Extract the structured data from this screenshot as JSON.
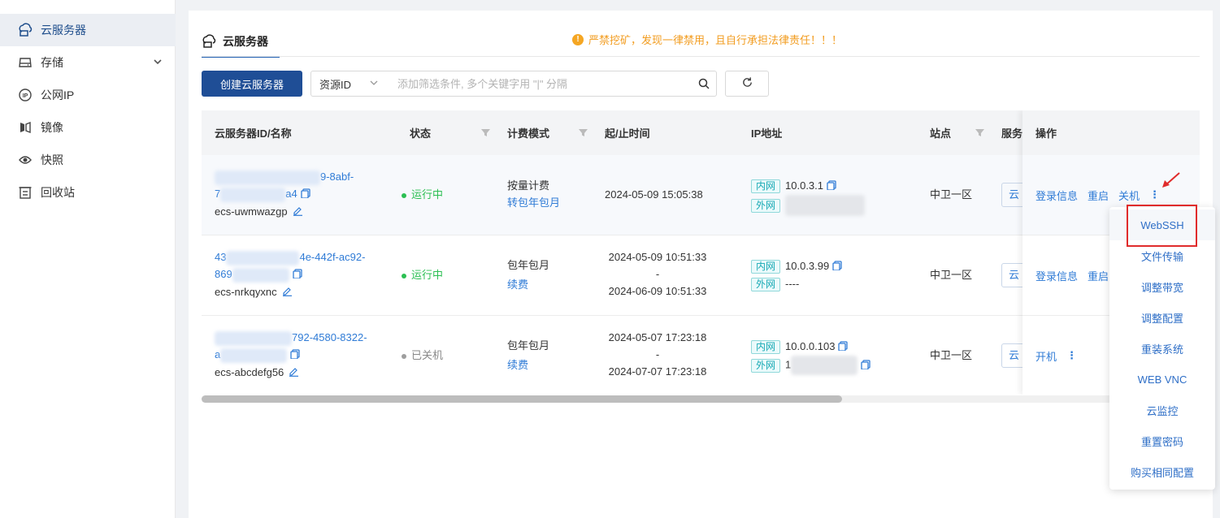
{
  "sidebar": {
    "items": [
      {
        "label": "云服务器",
        "icon": "cloud-server-icon",
        "active": true
      },
      {
        "label": "存储",
        "icon": "storage-icon"
      },
      {
        "label": "公网IP",
        "icon": "ip-icon"
      },
      {
        "label": "镜像",
        "icon": "image-icon"
      },
      {
        "label": "快照",
        "icon": "snapshot-icon"
      },
      {
        "label": "回收站",
        "icon": "recycle-bin-icon"
      }
    ]
  },
  "header": {
    "tab_label": "云服务器",
    "warning": "严禁挖矿，发现一律禁用，且自行承担法律责任！！！",
    "warning_icon": "!"
  },
  "toolbar": {
    "create_label": "创建云服务器",
    "filter_select": "资源ID",
    "search_placeholder": "添加筛选条件, 多个关键字用 \"|\" 分隔"
  },
  "table": {
    "columns": {
      "id_name": "云服务器ID/名称",
      "status": "状态",
      "billing": "计费模式",
      "time": "起/止时间",
      "ip": "IP地址",
      "site": "站点",
      "service": "服务",
      "ops": "操作"
    },
    "rows": [
      {
        "id_line1_suffix": "9-8abf-",
        "id_line2_prefix": "7",
        "id_line2_suffix": "a4",
        "name": "ecs-uwmwazgp",
        "status": "运行中",
        "billing": "按量计费",
        "billing_link": "转包年包月",
        "start": "2024-05-09 15:05:38",
        "end": "",
        "dash": "",
        "inner_tag": "内网",
        "inner_ip": "10.0.3.1",
        "outer_tag": "外网",
        "outer_ip": "",
        "site": "中卫一区",
        "service": "云",
        "ops": [
          "登录信息",
          "重启",
          "关机"
        ],
        "more": "⋮"
      },
      {
        "id_line1_prefix": "43",
        "id_line1_suffix": "4e-442f-ac92-",
        "id_line2_prefix": "869",
        "id_line2_suffix": "",
        "name": "ecs-nrkqyxnc",
        "status": "运行中",
        "billing": "包年包月",
        "billing_link": "续费",
        "start": "2024-05-09 10:51:33",
        "dash": "-",
        "end": "2024-06-09 10:51:33",
        "inner_tag": "内网",
        "inner_ip": "10.0.3.99",
        "outer_tag": "外网",
        "outer_ip": "----",
        "site": "中卫一区",
        "service": "云",
        "ops": [
          "登录信息",
          "重启"
        ]
      },
      {
        "id_line1_suffix": "792-4580-8322-",
        "id_line2_prefix": "a",
        "name": "ecs-abcdefg56",
        "status": "已关机",
        "billing": "包年包月",
        "billing_link": "续费",
        "start": "2024-05-07 17:23:18",
        "dash": "-",
        "end": "2024-07-07 17:23:18",
        "inner_tag": "内网",
        "inner_ip": "10.0.0.103",
        "outer_tag": "外网",
        "outer_ip": "1",
        "site": "中卫一区",
        "service": "云",
        "ops": [
          "开机"
        ],
        "more": "⋮"
      }
    ]
  },
  "dropdown": {
    "items": [
      "WebSSH",
      "文件传输",
      "调整带宽",
      "调整配置",
      "重装系统",
      "WEB VNC",
      "云监控",
      "重置密码",
      "购买相同配置"
    ]
  },
  "colors": {
    "primary": "#1f4e96",
    "link": "#2f7bd6",
    "running": "#2bbf52",
    "warning": "#f29c1f",
    "highlight_box": "#e02b2b"
  }
}
